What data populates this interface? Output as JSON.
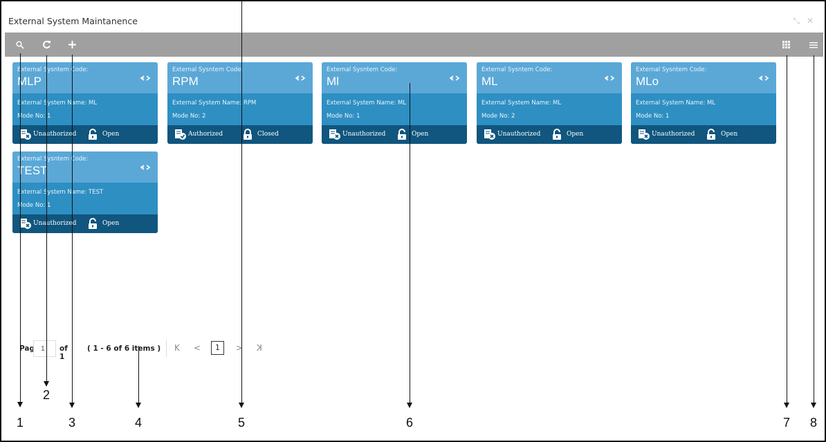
{
  "window": {
    "title": "External System Maintanence",
    "controls": [
      "minimize-icon",
      "close-icon"
    ]
  },
  "toolbar": {
    "buttons": [
      {
        "name": "search",
        "icon": "search-icon"
      },
      {
        "name": "refresh",
        "icon": "refresh-icon"
      },
      {
        "name": "add",
        "icon": "plus-icon"
      }
    ],
    "view_toggles": [
      {
        "name": "tile-view",
        "icon": "grid-icon"
      },
      {
        "name": "list-view",
        "icon": "list-icon"
      }
    ]
  },
  "cards": [
    {
      "code_label": "External Sysntem Code:",
      "code": "MLP",
      "name_text": "External System Name: ML",
      "mode_text": "Mode No: 1",
      "auth": "Unauthorized",
      "lock": "Open"
    },
    {
      "code_label": "External Sysntem Code:",
      "code": "RPM",
      "name_text": "External System Name: RPM",
      "mode_text": "Mode No: 2",
      "auth": "Authorized",
      "lock": "Closed"
    },
    {
      "code_label": "External Sysntem Code:",
      "code": "Ml",
      "name_text": "External System Name: ML",
      "mode_text": "Mode No: 1",
      "auth": "Unauthorized",
      "lock": "Open"
    },
    {
      "code_label": "External Sysntem Code:",
      "code": "ML",
      "name_text": "External System Name: ML",
      "mode_text": "Mode No: 2",
      "auth": "Unauthorized",
      "lock": "Open"
    },
    {
      "code_label": "External Sysntem Code:",
      "code": "MLo",
      "name_text": "External System Name: ML",
      "mode_text": "Mode No: 1",
      "auth": "Unauthorized",
      "lock": "Open"
    },
    {
      "code_label": "External Sysntem Code:",
      "code": "TEST",
      "name_text": "External System Name: TEST",
      "mode_text": "Mode No: 1",
      "auth": "Unauthorized",
      "lock": "Open"
    }
  ],
  "pagination": {
    "page_label": "Page",
    "page_value": "1",
    "of_label": "of 1",
    "items_text": "( 1 - 6 of 6 items )",
    "first": "K",
    "prev": "<",
    "current": "1",
    "next": ">",
    "last": "K"
  },
  "callouts": [
    "1",
    "2",
    "3",
    "4",
    "5",
    "6",
    "7",
    "8"
  ],
  "colors": {
    "toolbar": "#a0a0a0",
    "card_header": "#5ba8d7",
    "card_body": "#2e8fc3",
    "card_status": "#10567e"
  }
}
